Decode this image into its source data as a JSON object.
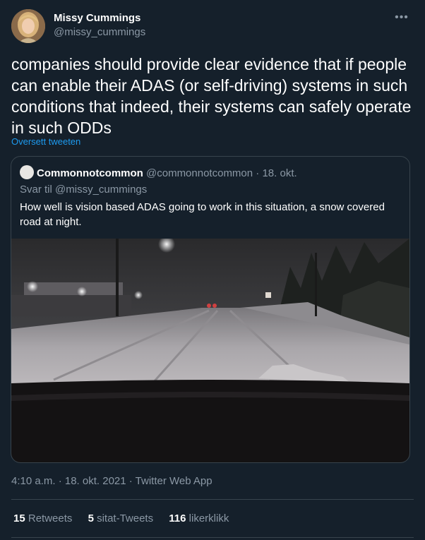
{
  "author": {
    "name": "Missy Cummings",
    "handle": "@missy_cummings"
  },
  "more_icon": "more-horizontal-icon",
  "tweet_text": "companies should provide clear evidence that if people can enable their ADAS (or self-driving) systems in such conditions that indeed, their systems can safely operate in such ODDs",
  "translate_label": "Oversett tweeten",
  "quote": {
    "name": "Commonnotcommon",
    "handle": "@commonnotcommon",
    "separator": "·",
    "date": "18. okt.",
    "reply_to": "Svar til @missy_cummings",
    "text": "How well is vision based ADAS going to work in this situation, a snow covered road at night."
  },
  "timestamp": "4:10 a.m. · 18. okt. 2021 · Twitter Web App",
  "stats": {
    "retweets_count": "15",
    "retweets_label": "Retweets",
    "quotes_count": "5",
    "quotes_label": "sitat-Tweets",
    "likes_count": "116",
    "likes_label": "likerklikk"
  },
  "colors": {
    "background": "#15202b",
    "text": "#ffffff",
    "secondary_text": "#8b98a5",
    "link": "#1d9bf0",
    "border": "#38444d"
  }
}
